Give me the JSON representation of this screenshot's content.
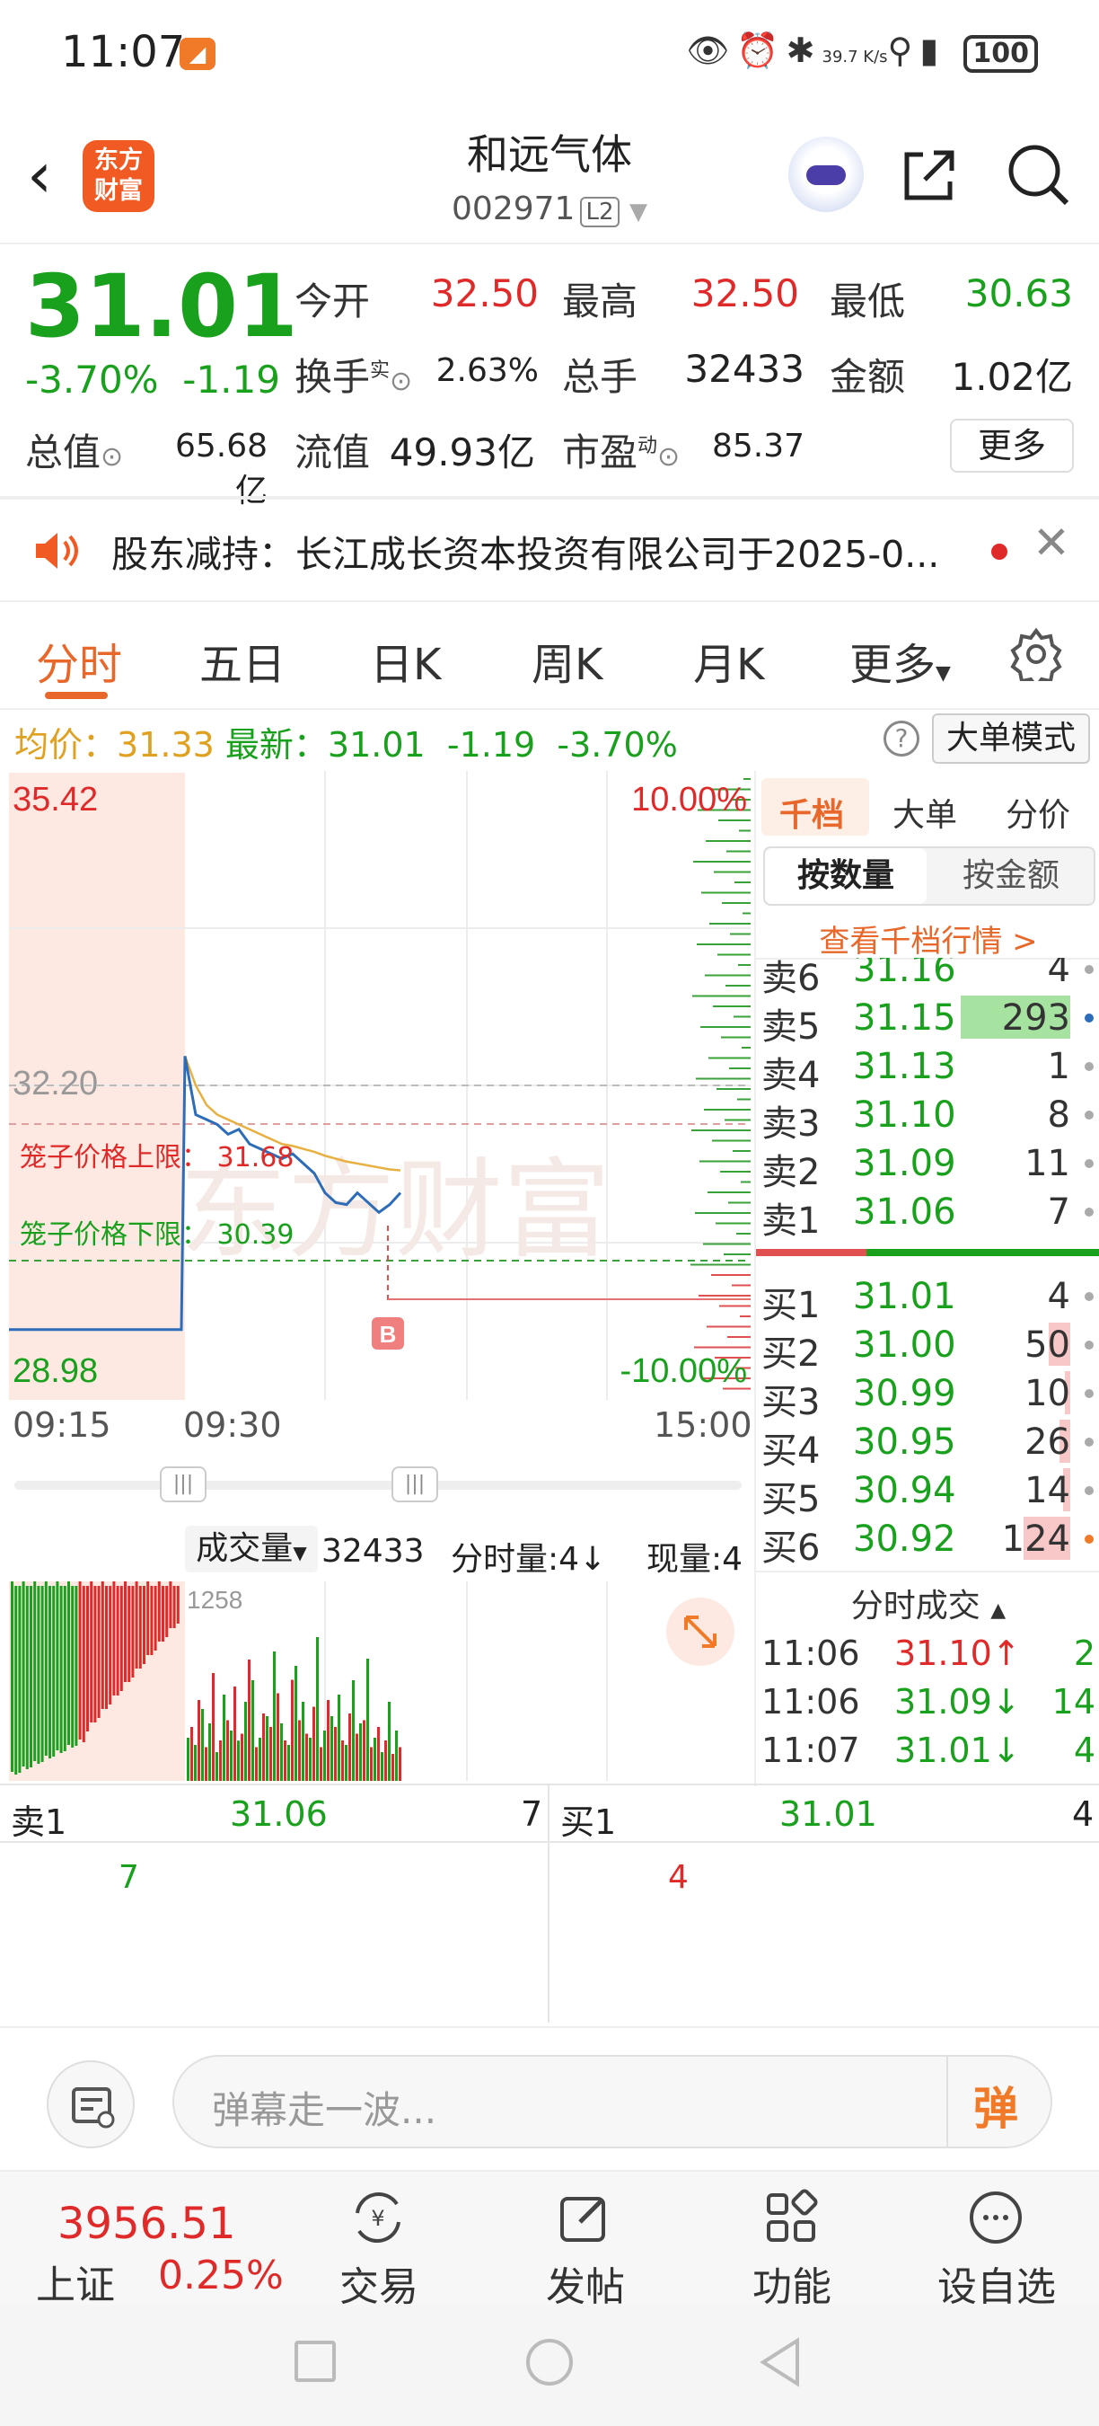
{
  "status_bar": {
    "time": "11:07",
    "net_speed": "39.7 K/s",
    "battery": "100"
  },
  "header": {
    "logo_text": "东方财富",
    "stock_name": "和远气体",
    "stock_code": "002971",
    "level": "L2"
  },
  "quote": {
    "price": "31.01",
    "change_pct": "-3.70%",
    "change": "-1.19",
    "open_label": "今开",
    "open": "32.50",
    "high_label": "最高",
    "high": "32.50",
    "low_label": "最低",
    "low": "30.63",
    "turnover_label": "换手",
    "turnover_sup": "实",
    "turnover": "2.63%",
    "volume_label": "总手",
    "volume": "32433",
    "amount_label": "金额",
    "amount": "1.02亿",
    "mcap_label": "总值",
    "mcap": "65.68亿",
    "float_label": "流值",
    "float": "49.93亿",
    "pe_label": "市盈",
    "pe_sup": "动",
    "pe": "85.37",
    "more_button": "更多"
  },
  "notice": {
    "text": "股东减持：长江成长资本投资有限公司于2025-0..."
  },
  "tabs": [
    "分时",
    "五日",
    "日K",
    "周K",
    "月K",
    "更多"
  ],
  "info_bar": {
    "avg_label": "均价：",
    "avg": "31.33",
    "last_label": "最新：",
    "last": "31.01",
    "change": "-1.19",
    "change_pct": "-3.70%",
    "mode_button": "大单模式"
  },
  "chart": {
    "top_price": "35.42",
    "bottom_price": "28.98",
    "top_pct": "10.00%",
    "bottom_pct": "-10.00%",
    "ref_price": "32.20",
    "upper_limit": "笼子价格上限：  31.68",
    "lower_limit": "笼子价格下限：  30.39",
    "buy_marker": "B",
    "watermark": "东方财富",
    "times": [
      "09:15",
      "09:30",
      "15:00"
    ]
  },
  "chart_data": {
    "type": "line",
    "x": [
      "09:15",
      "09:20",
      "09:25",
      "09:30",
      "09:31",
      "09:32",
      "09:33",
      "09:34",
      "09:35",
      "09:36",
      "09:37",
      "09:38",
      "09:39",
      "09:40",
      "09:41",
      "09:42",
      "09:43",
      "09:44",
      "09:45",
      "09:46",
      "09:47",
      "09:48",
      "09:49",
      "09:50"
    ],
    "series": [
      {
        "values": [
          29.7,
          29.7,
          29.7,
          32.5,
          31.9,
          31.85,
          31.8,
          31.7,
          31.75,
          31.6,
          31.55,
          31.5,
          31.45,
          31.5,
          31.4,
          31.3,
          31.1,
          31.0,
          30.98,
          31.1,
          31.0,
          30.9,
          30.98,
          31.1
        ]
      },
      {
        "values": [
          null,
          null,
          null,
          32.5,
          32.2,
          32.0,
          31.9,
          31.85,
          31.8,
          31.75,
          31.7,
          31.65,
          31.6,
          31.58,
          31.55,
          31.52,
          31.48,
          31.45,
          31.42,
          31.4,
          31.38,
          31.36,
          31.34,
          31.33
        ]
      }
    ],
    "ylim": [
      28.98,
      35.42
    ]
  },
  "volume": {
    "label": "成交量",
    "total": "32433",
    "tick_label": "分时量:4↓",
    "now_label": "现量:4",
    "max": "1258",
    "bars_green": [
      30,
      25,
      50,
      40,
      20,
      60,
      35,
      28,
      55,
      70,
      30,
      45,
      90,
      40,
      25,
      80,
      55,
      30,
      100,
      35,
      45,
      60,
      25,
      70,
      40,
      85,
      30,
      20,
      55,
      35
    ],
    "bars_red": [
      40,
      60,
      25,
      80,
      30,
      45,
      70,
      35,
      90,
      25,
      50,
      40,
      65,
      30,
      75,
      45,
      35,
      55,
      25,
      60,
      40,
      30,
      50,
      35,
      45,
      25,
      40,
      30,
      20,
      25
    ]
  },
  "orderbook": {
    "tabs": [
      "千档",
      "大单",
      "分价"
    ],
    "seg": [
      "按数量",
      "按金额"
    ],
    "thousand_link": "查看千档行情 >",
    "asks": [
      {
        "label": "卖6",
        "price": "31.16",
        "qty": "4"
      },
      {
        "label": "卖5",
        "price": "31.15",
        "qty": "293"
      },
      {
        "label": "卖4",
        "price": "31.13",
        "qty": "1"
      },
      {
        "label": "卖3",
        "price": "31.10",
        "qty": "8"
      },
      {
        "label": "卖2",
        "price": "31.09",
        "qty": "11"
      },
      {
        "label": "卖1",
        "price": "31.06",
        "qty": "7"
      }
    ],
    "bids": [
      {
        "label": "买1",
        "price": "31.01",
        "qty": "4"
      },
      {
        "label": "买2",
        "price": "31.00",
        "qty": "50"
      },
      {
        "label": "买3",
        "price": "30.99",
        "qty": "10"
      },
      {
        "label": "买4",
        "price": "30.95",
        "qty": "26"
      },
      {
        "label": "买5",
        "price": "30.94",
        "qty": "14"
      },
      {
        "label": "买6",
        "price": "30.92",
        "qty": "124"
      }
    ],
    "ticks_title": "分时成交",
    "ticks": [
      {
        "time": "11:06",
        "price": "31.10↑",
        "qty": "2"
      },
      {
        "time": "11:06",
        "price": "31.09↓",
        "qty": "14"
      },
      {
        "time": "11:07",
        "price": "31.01↓",
        "qty": "4"
      }
    ]
  },
  "best": {
    "ask_label": "卖1",
    "ask_price": "31.06",
    "ask_qty": "7",
    "bid_label": "买1",
    "bid_price": "31.01",
    "bid_qty": "4",
    "ask_sub": "7",
    "bid_sub": "4"
  },
  "comment": {
    "placeholder": "弹幕走一波...",
    "dan": "弹"
  },
  "bottom_nav": {
    "index_value": "3956.51",
    "index_name": "上证",
    "index_pct": "0.25%",
    "items": [
      "交易",
      "发帖",
      "功能",
      "设自选"
    ]
  }
}
